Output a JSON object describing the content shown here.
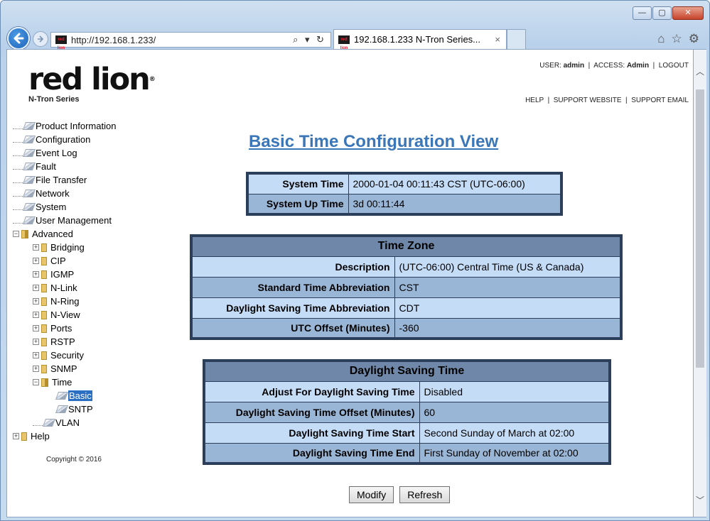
{
  "browser": {
    "url": "http://192.168.1.233/",
    "tab_title": "192.168.1.233 N-Tron Series...",
    "tab_close": "×",
    "favicon_text": "red lion",
    "address_controls": "⌕ ▾ ↻",
    "window_buttons": [
      "—",
      "▢",
      "✕"
    ],
    "tools": [
      "⌂",
      "☆",
      "⚙"
    ]
  },
  "header": {
    "logo_text": "red lion",
    "logo_reg": "®",
    "logo_sub": "N-Tron Series",
    "user_label": "USER:",
    "user_value": "admin",
    "access_label": "ACCESS:",
    "access_value": "Admin",
    "logout": "LOGOUT",
    "help": "HELP",
    "support_website": "SUPPORT WEBSITE",
    "support_email": "SUPPORT EMAIL"
  },
  "nav": {
    "items": [
      {
        "label": "Product Information"
      },
      {
        "label": "Configuration"
      },
      {
        "label": "Event Log"
      },
      {
        "label": "Fault"
      },
      {
        "label": "File Transfer"
      },
      {
        "label": "Network"
      },
      {
        "label": "System"
      },
      {
        "label": "User Management"
      }
    ],
    "advanced": "Advanced",
    "advanced_items": [
      "Bridging",
      "CIP",
      "IGMP",
      "N-Link",
      "N-Ring",
      "N-View",
      "Ports",
      "RSTP",
      "Security",
      "SNMP"
    ],
    "time": "Time",
    "time_items": [
      "Basic",
      "SNTP"
    ],
    "vlan": "VLAN",
    "help": "Help",
    "copyright": "Copyright © 2016"
  },
  "main": {
    "title": "Basic Time Configuration View",
    "system": {
      "rows": [
        {
          "label": "System Time",
          "value": "2000-01-04 00:11:43 CST (UTC-06:00)"
        },
        {
          "label": "System Up Time",
          "value": "3d 00:11:44"
        }
      ]
    },
    "timezone": {
      "heading": "Time Zone",
      "rows": [
        {
          "label": "Description",
          "value": "(UTC-06:00) Central Time (US & Canada)"
        },
        {
          "label": "Standard Time Abbreviation",
          "value": "CST"
        },
        {
          "label": "Daylight Saving Time Abbreviation",
          "value": "CDT"
        },
        {
          "label": "UTC Offset (Minutes)",
          "value": "-360"
        }
      ]
    },
    "dst": {
      "heading": "Daylight Saving Time",
      "rows": [
        {
          "label": "Adjust For Daylight Saving Time",
          "value": "Disabled"
        },
        {
          "label": "Daylight Saving Time Offset (Minutes)",
          "value": "60"
        },
        {
          "label": "Daylight Saving Time Start",
          "value": "Second Sunday of March at 02:00"
        },
        {
          "label": "Daylight Saving Time End",
          "value": "First Sunday of November at 02:00"
        }
      ]
    },
    "buttons": {
      "modify": "Modify",
      "refresh": "Refresh"
    }
  }
}
